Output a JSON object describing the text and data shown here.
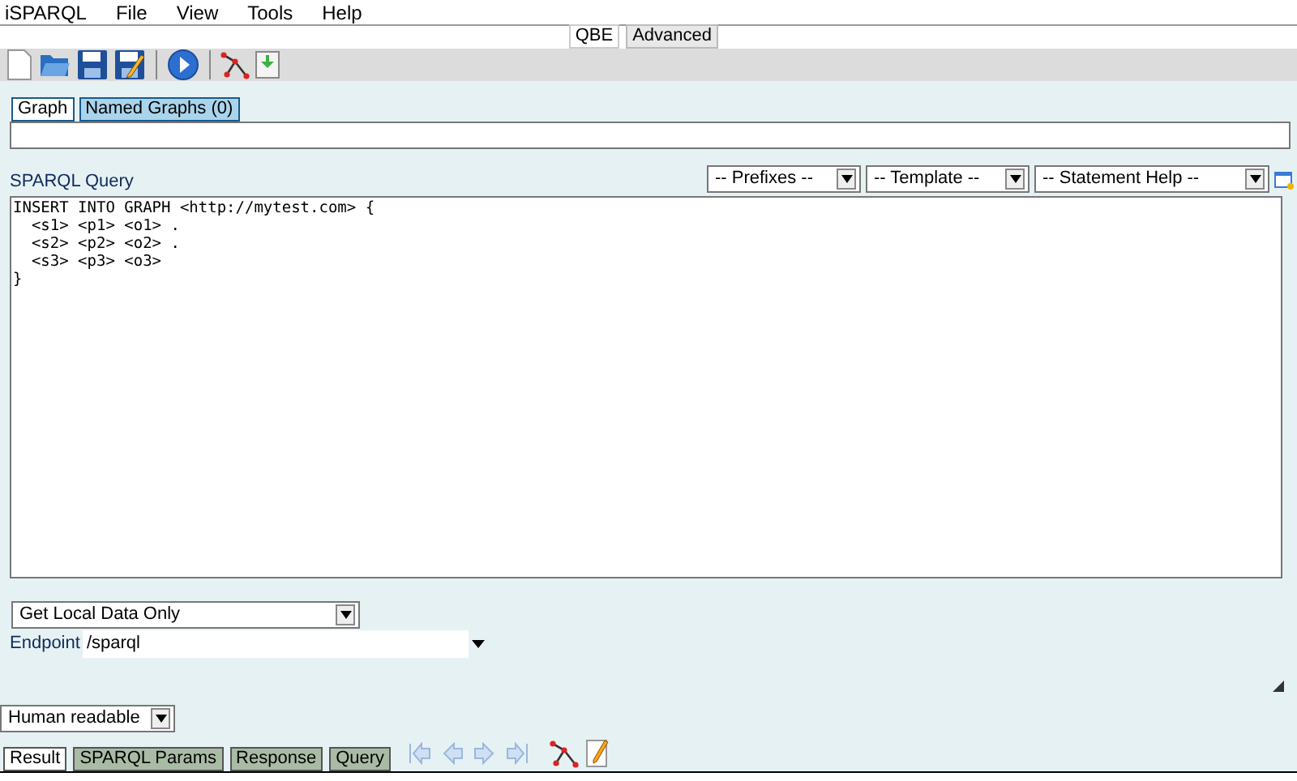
{
  "menu": [
    "iSPARQL",
    "File",
    "View",
    "Tools",
    "Help"
  ],
  "mode_tabs": [
    {
      "label": "QBE",
      "selected": false
    },
    {
      "label": "Advanced",
      "selected": true
    }
  ],
  "graph_tabs": [
    {
      "label": "Graph",
      "selected": true
    },
    {
      "label": "Named Graphs (0)",
      "selected": false
    }
  ],
  "query": {
    "label": "SPARQL Query",
    "prefixes": "-- Prefixes --",
    "template": "-- Template --",
    "statement_help": "-- Statement Help --",
    "text": "INSERT INTO GRAPH <http://mytest.com> {\n  <s1> <p1> <o1> .\n  <s2> <p2> <o2> .\n  <s3> <p3> <o3>\n}"
  },
  "data_source": "Get Local Data Only",
  "endpoint": {
    "label": "Endpoint",
    "value": "/sparql"
  },
  "format": "Human readable",
  "result_tabs": [
    {
      "label": "Result",
      "selected": true
    },
    {
      "label": "SPARQL Params",
      "selected": false
    },
    {
      "label": "Response",
      "selected": false
    },
    {
      "label": "Query",
      "selected": false
    }
  ]
}
